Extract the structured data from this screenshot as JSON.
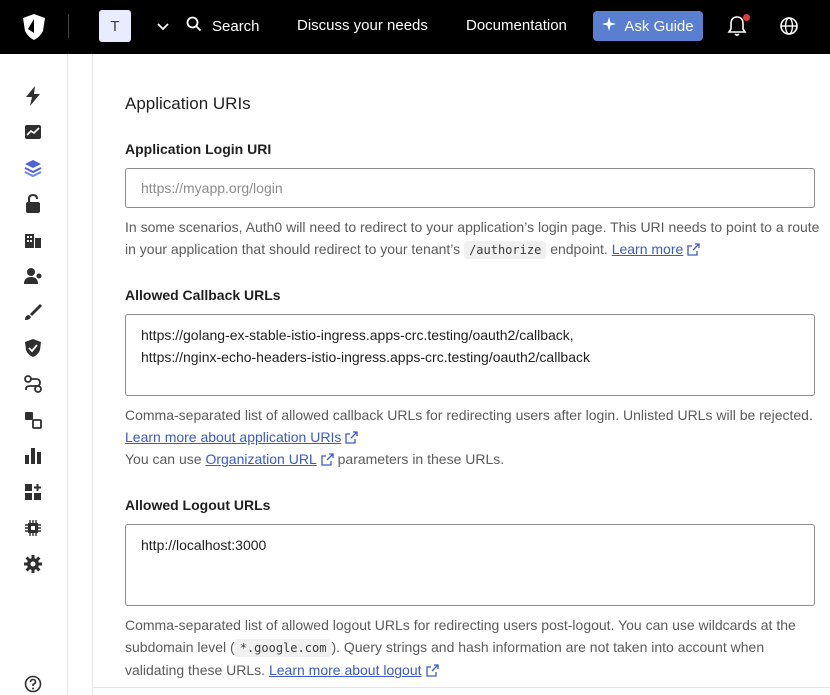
{
  "topbar": {
    "tenant_initial": "T",
    "search_label": "Search",
    "discuss_label": "Discuss your needs",
    "docs_label": "Documentation",
    "ask_guide_label": "Ask Guide"
  },
  "sidebar": {
    "items": [
      {
        "icon": "bolt-icon"
      },
      {
        "icon": "activity-chart-icon"
      },
      {
        "icon": "applications-icon"
      },
      {
        "icon": "authentication-icon"
      },
      {
        "icon": "organizations-icon"
      },
      {
        "icon": "user-management-icon"
      },
      {
        "icon": "branding-icon"
      },
      {
        "icon": "security-icon"
      },
      {
        "icon": "actions-icon"
      },
      {
        "icon": "auth-pipeline-icon"
      },
      {
        "icon": "monitoring-icon"
      },
      {
        "icon": "marketplace-icon"
      },
      {
        "icon": "extensions-icon"
      },
      {
        "icon": "settings-icon"
      },
      {
        "icon": "help-icon"
      }
    ]
  },
  "main": {
    "section_title": "Application URIs",
    "login_uri": {
      "label": "Application Login URI",
      "placeholder": "https://myapp.org/login",
      "help_before": "In some scenarios, Auth0 will need to redirect to your application’s login page. This URI needs to point to a route in your application that should redirect to your tenant’s ",
      "help_code": "/authorize",
      "help_after": " endpoint. ",
      "help_link": "Learn more"
    },
    "callbacks": {
      "label": "Allowed Callback URLs",
      "value_line1": "https://golang-ex-stable-istio-ingress.apps-crc.testing/oauth2/callback,",
      "value_line2": "https://nginx-echo-headers-istio-ingress.apps-crc.testing/oauth2/callback",
      "help1": "Comma-separated list of allowed callback URLs for redirecting users after login. Unlisted URLs will be rejected. ",
      "help1_link": "Learn more about application URIs",
      "help2_before": "You can use ",
      "help2_link": "Organization URL",
      "help2_after": " parameters in these URLs."
    },
    "logout": {
      "label": "Allowed Logout URLs",
      "value": "http://localhost:3000",
      "help_before": "Comma-separated list of allowed logout URLs for redirecting users post-logout. You can use wildcards at the subdomain level (",
      "help_code": "*.google.com",
      "help_after": "). Query strings and hash information are not taken into account when validating these URLs. ",
      "help_link": "Learn more about logout"
    }
  },
  "colors": {
    "topbar_bg": "#000000",
    "ask_guide_bg": "#5a7fd1",
    "link": "#3b5ac8",
    "notification_dot": "#e0393e",
    "active_nav": "#4a63d6"
  }
}
